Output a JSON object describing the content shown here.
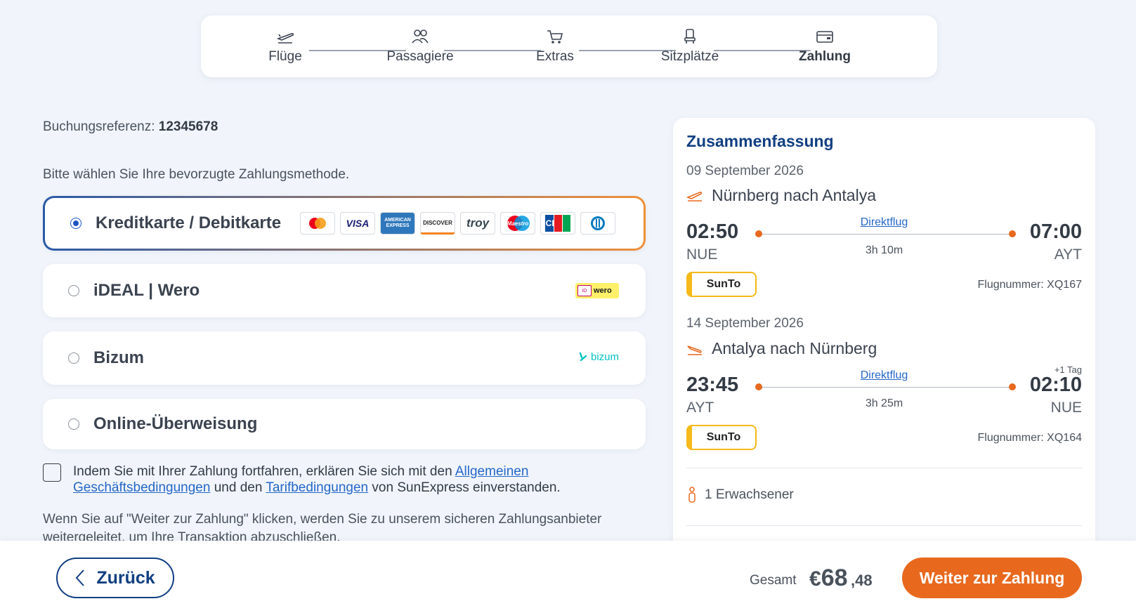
{
  "stepper": {
    "steps": [
      {
        "label": "Flüge",
        "icon": "plane-icon"
      },
      {
        "label": "Passagiere",
        "icon": "passengers-icon"
      },
      {
        "label": "Extras",
        "icon": "cart-icon"
      },
      {
        "label": "Sitzplätze",
        "icon": "seat-icon"
      },
      {
        "label": "Zahlung",
        "icon": "wallet-icon"
      }
    ],
    "active_index": 4
  },
  "booking": {
    "ref_label": "Buchungsreferenz:",
    "ref_value": "12345678"
  },
  "payment": {
    "prompt": "Bitte wählen Sie Ihre bevorzugte Zahlungsmethode.",
    "methods": [
      {
        "name": "Kreditkarte / Debitkarte",
        "selected": true
      },
      {
        "name": "iDEAL | Wero",
        "selected": false
      },
      {
        "name": "Bizum",
        "selected": false
      },
      {
        "name": "Online-Überweisung",
        "selected": false
      }
    ],
    "cards": [
      "Mastercard",
      "VISA",
      "AMERICAN EXPRESS",
      "DISCOVER",
      "troy",
      "Maestro",
      "JCB",
      "Diners"
    ],
    "ideal_badge": "wero",
    "bizum_badge": "bizum"
  },
  "terms": {
    "text_before": "Indem Sie mit Ihrer Zahlung fortfahren, erklären Sie sich mit den ",
    "link1": "Allgemeinen Geschäftsbedingungen",
    "text_mid": " und den ",
    "link2": "Tarifbedingungen",
    "text_after": " von SunExpress einverstanden."
  },
  "info": "Wenn Sie auf \"Weiter zur Zahlung\" klicken, werden Sie zu unserem sicheren Zahlungsanbieter weitergeleitet, um Ihre Transaktion abzuschließen.",
  "summary": {
    "title": "Zusammenfassung",
    "outbound": {
      "date": "09 September 2026",
      "route": "Nürnberg nach Antalya",
      "dep_time": "02:50",
      "dep_code": "NUE",
      "arr_time": "07:00",
      "arr_code": "AYT",
      "type": "Direktflug",
      "duration": "3h 10m",
      "fare": "SunTo",
      "flight_no": "Flugnummer: XQ167"
    },
    "return": {
      "date": "14 September 2026",
      "route": "Antalya nach Nürnberg",
      "dep_time": "23:45",
      "dep_code": "AYT",
      "arr_time": "02:10",
      "arr_code": "NUE",
      "plus_day": "+1 Tag",
      "type": "Direktflug",
      "duration": "3h 25m",
      "fare": "SunTo",
      "flight_no": "Flugnummer: XQ164"
    },
    "passengers": "1 Erwachsener"
  },
  "footer": {
    "back_label": "Zurück",
    "total_label": "Gesamt",
    "currency": "€",
    "price_int": "68",
    "price_dec": ",48",
    "pay_label": "Weiter zur Zahlung"
  },
  "colors": {
    "primary": "#113f82",
    "accent": "#e8691e",
    "link": "#2567c8",
    "fare_badge": "#f6b91a"
  }
}
